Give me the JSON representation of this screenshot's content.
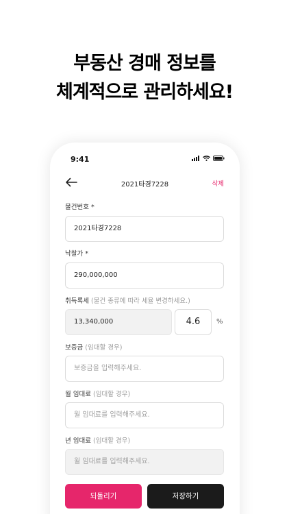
{
  "promo": {
    "line1": "부동산 경매 정보를",
    "line2": "체계적으로 관리하세요!"
  },
  "status": {
    "time": "9:41"
  },
  "header": {
    "title": "2021타경7228",
    "delete_label": "삭제"
  },
  "form": {
    "case_number": {
      "label": "물건번호 *",
      "value": "2021타경7228"
    },
    "winning_bid": {
      "label": "낙찰가 *",
      "value": "290,000,000"
    },
    "acquisition_tax": {
      "label": "취득록세",
      "hint": "(물건 종류에 따라 세율 변경하세요.)",
      "value": "13,340,000",
      "rate": "4.6",
      "rate_unit": "%"
    },
    "deposit": {
      "label": "보증금",
      "hint": "(임대할 경우)",
      "placeholder": "보증금을 입력해주세요."
    },
    "monthly_rent": {
      "label": "월 임대료",
      "hint": "(임대할 경우)",
      "placeholder": "월 임대료를 입력해주세요."
    },
    "annual_rent": {
      "label": "년 임대료",
      "hint": "(임대할 경우)",
      "placeholder": "월 임대료를 입력해주세요."
    }
  },
  "actions": {
    "revert_label": "되돌리기",
    "save_label": "저장하기"
  },
  "colors": {
    "accent": "#e6266b",
    "dark": "#1b1b1b"
  }
}
